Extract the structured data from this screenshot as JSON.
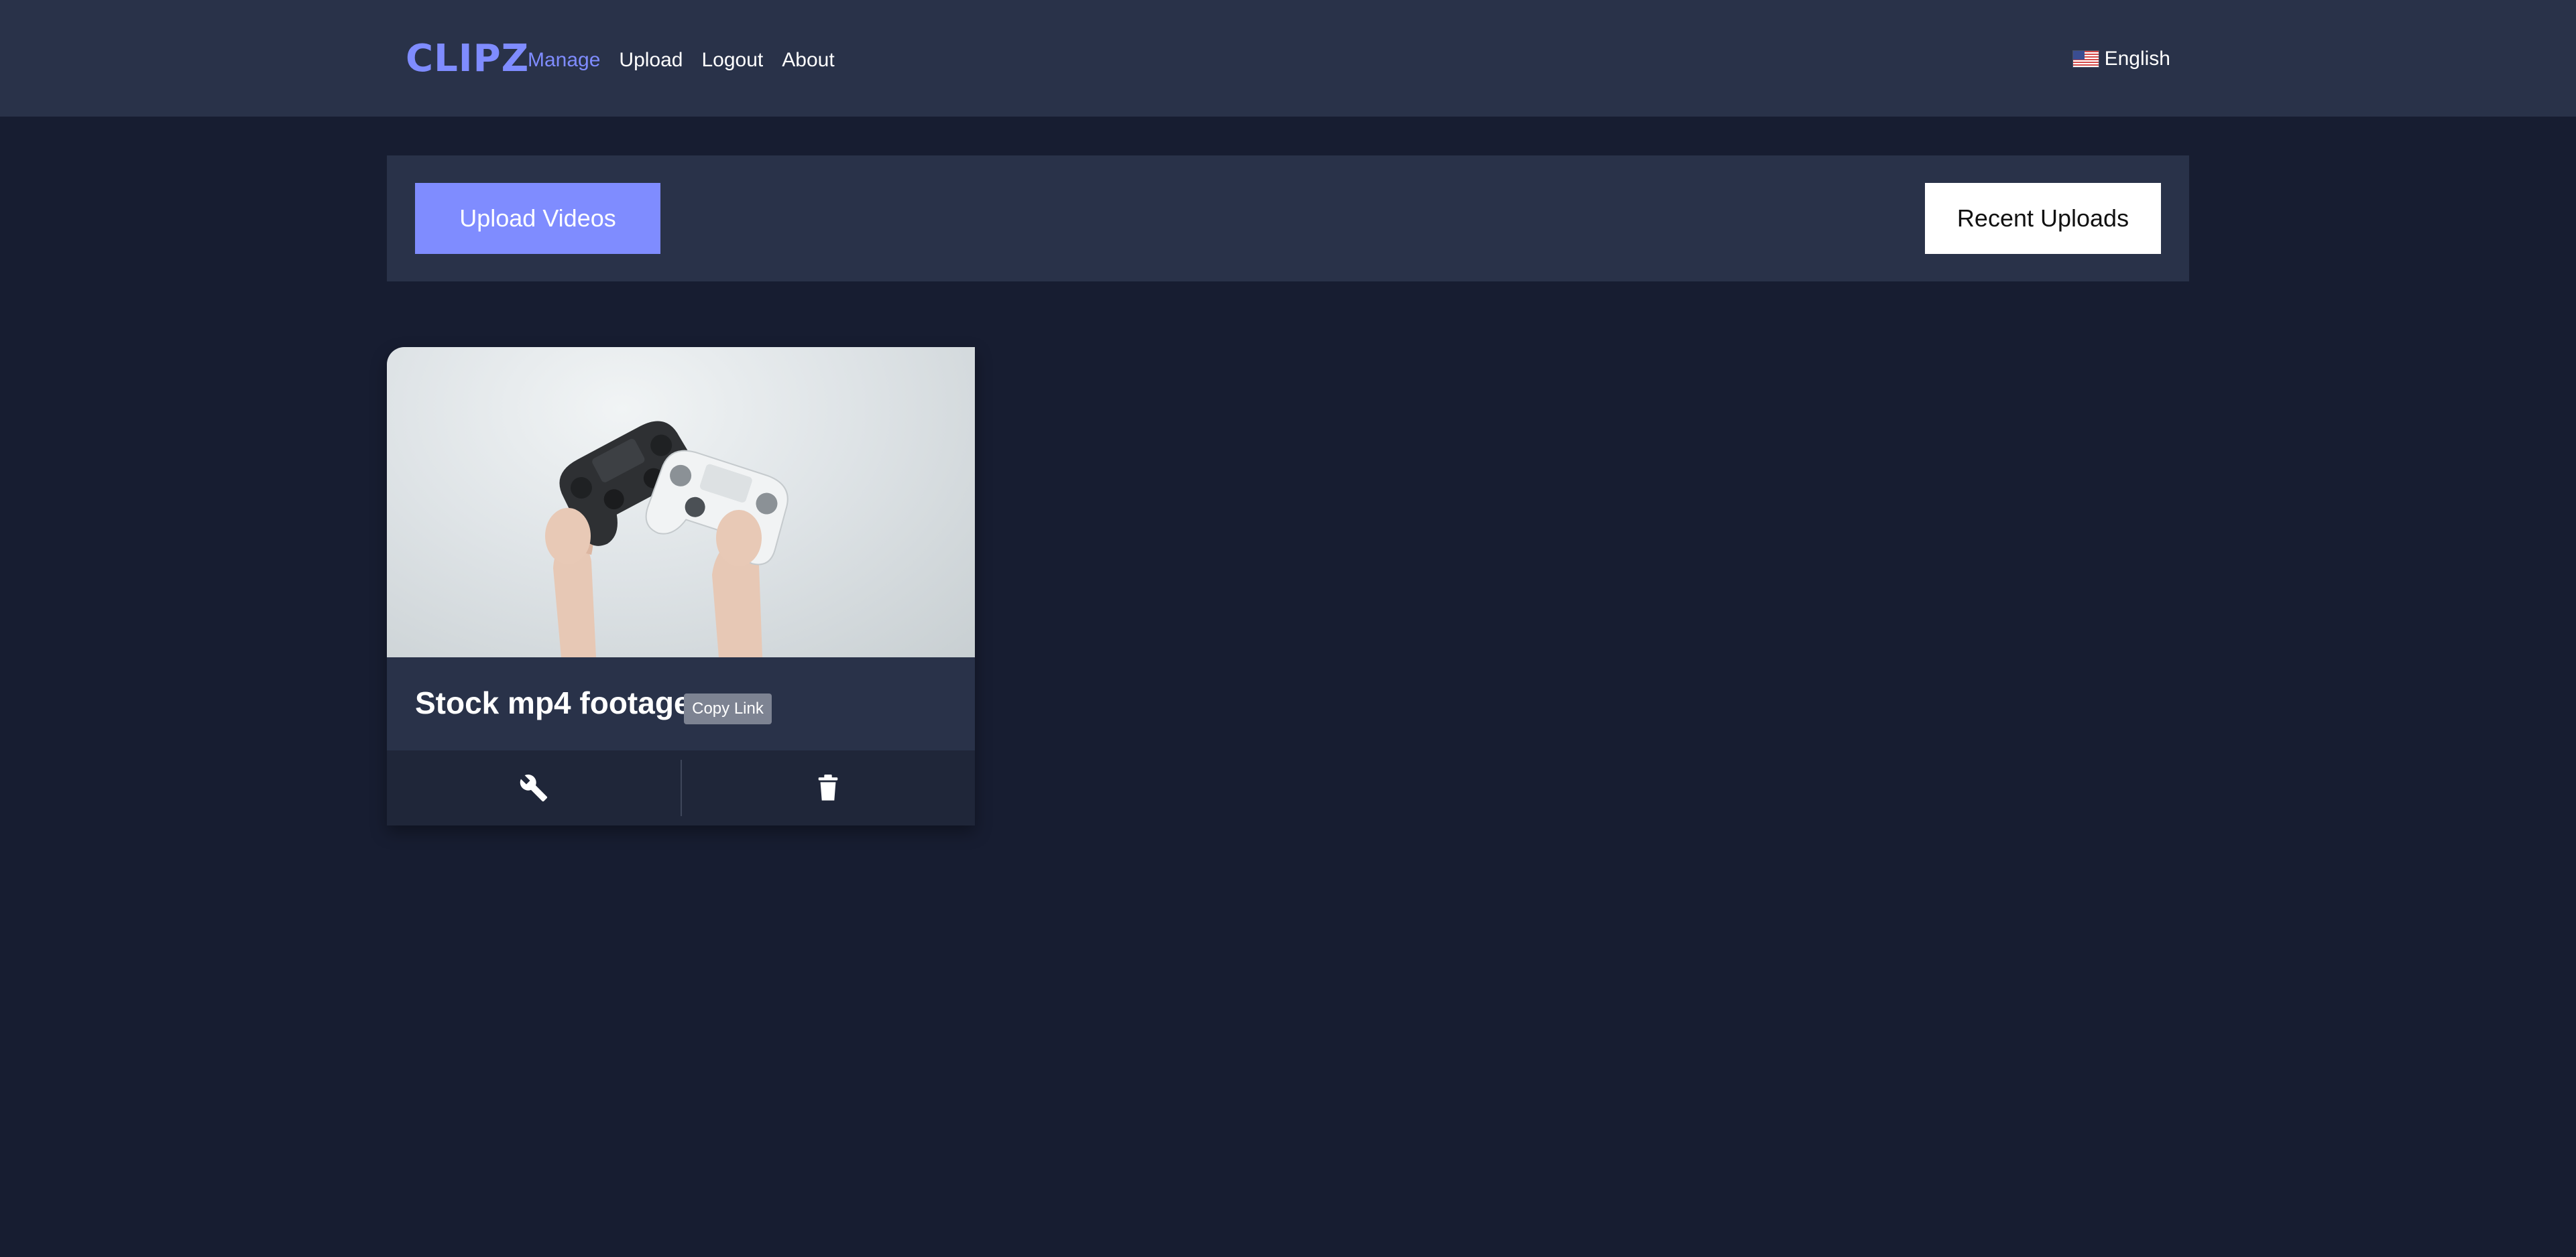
{
  "header": {
    "logo": "CLIPZ",
    "nav": [
      {
        "label": "Manage",
        "active": true
      },
      {
        "label": "Upload",
        "active": false
      },
      {
        "label": "Logout",
        "active": false
      },
      {
        "label": "About",
        "active": false
      }
    ],
    "language": {
      "label": "English",
      "flag_icon": "us-flag-icon"
    }
  },
  "toolbar": {
    "upload_label": "Upload Videos",
    "sort_label": "Recent Uploads"
  },
  "clips": [
    {
      "title": "Stock mp4 footage",
      "copy_label": "Copy Link",
      "thumbnail_icon": "video-thumbnail-game-controllers",
      "actions": [
        {
          "icon": "wrench-icon"
        },
        {
          "icon": "trash-icon"
        }
      ]
    }
  ],
  "colors": {
    "background": "#171d31",
    "surface": "#293249",
    "accent": "#7f8cff",
    "actions_bar": "#1f2639",
    "badge": "#7d8392"
  }
}
